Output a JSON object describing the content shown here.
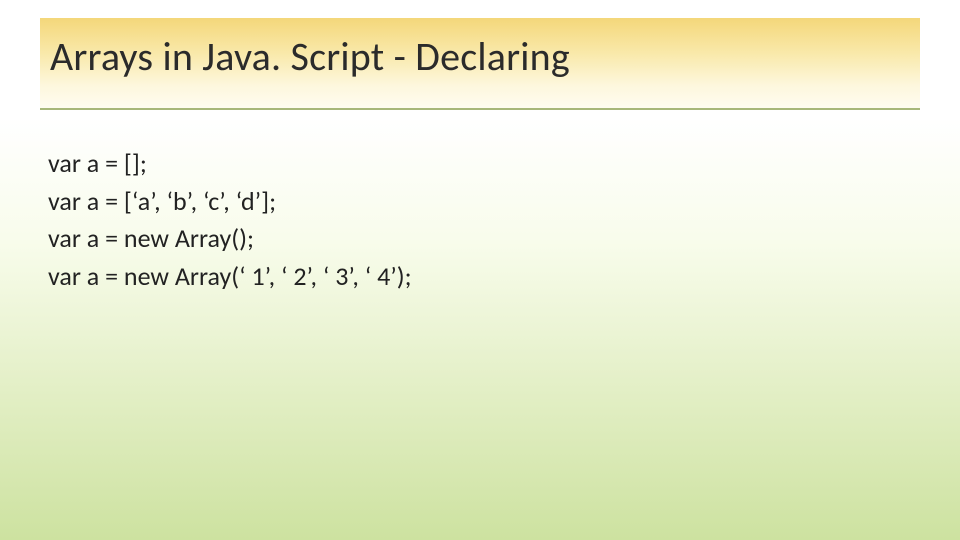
{
  "title": "Arrays in Java. Script - Declaring",
  "code_lines": [
    "var a = [];",
    "var a = [‘a’, ‘b’, ‘c’, ‘d’];",
    "var a = new Array();",
    "var a = new Array(‘ 1’, ‘ 2’, ‘ 3’, ‘ 4’);"
  ]
}
